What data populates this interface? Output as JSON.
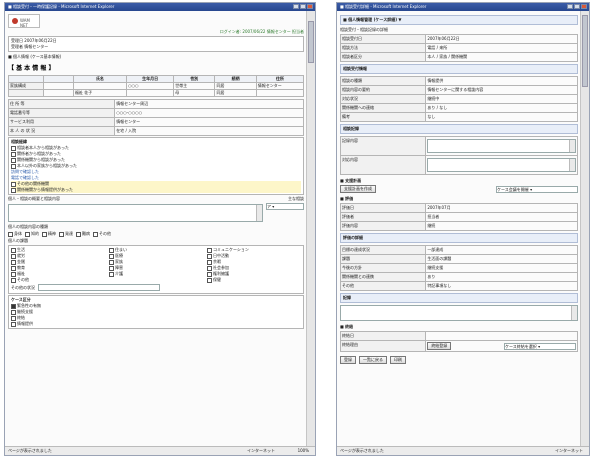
{
  "left_window": {
    "title": "■ 相談受付・一時保護記録 - Microsoft Internet Explorer",
    "logo_text": "WAM NET",
    "user_line": "ログイン者: 2007/06/22  情報センター 担当者",
    "header_rows": [
      "受理日  2007年06月22日",
      "受理者  情報センター"
    ],
    "section_title": "■ 個人情報 (ケース基本情報)",
    "basic_heading": "【 基 本 情 報 】",
    "basic_table": {
      "headers": [
        "",
        "",
        "氏名",
        "生年月日",
        "性別",
        "続柄",
        "住所"
      ],
      "rows": [
        [
          "家族構成",
          "",
          "",
          "○○○",
          "世帯主",
          "同居",
          "情報センター"
        ],
        [
          "",
          "",
          "福祉 花子",
          "",
          "母",
          "同居",
          ""
        ],
        [
          "",
          "",
          "",
          "",
          "",
          "",
          ""
        ]
      ],
      "info_rows": [
        [
          "住 所 等",
          "情報センター周辺"
        ],
        [
          "電話番号等",
          "○○○-○○○○"
        ],
        [
          "サービス利用",
          "情報センター"
        ],
        [
          "本 人 の 状 況",
          "在宅 / 入院"
        ]
      ]
    },
    "status_label": "相談経緯",
    "status_items": [
      "相談者本人から相談があった",
      "関係者から相談があった",
      "関係機関から相談があった",
      "本人以外の家族から相談があった"
    ],
    "status_links": [
      "訪問で確認した",
      "電話で確認した"
    ],
    "status_yellow_items": [
      "その他の関係機関",
      "関係機関から情報提供があった"
    ],
    "consult_label": "個人・相談の概要と相談内容",
    "consult_side_label": "主な相談",
    "consult_select": "ア",
    "checks_label": "個人の相談内容の種類",
    "checks_row": [
      "身体",
      "知的",
      "精神",
      "発達",
      "難病",
      "その他"
    ],
    "checks2_label": "個人の課題",
    "checks2": [
      "生活",
      "住まい",
      "就労",
      "医療",
      "金銭",
      "家族",
      "教育",
      "障害",
      "福祉",
      "介護",
      "その他",
      "",
      "コミュニケーション",
      "日中活動",
      "余暇",
      "社会参加",
      "権利擁護",
      "保健"
    ],
    "other_label": "その他の状況",
    "bottom_label": "ケース区分",
    "bottom_items": [
      "緊急性の有無",
      "継続支援",
      "終結",
      "情報提供"
    ],
    "status_text": "ページが表示されました",
    "status_zone": "インターネット",
    "status_zoom": "100%"
  },
  "right_window": {
    "title": "■ 相談受付詳細 - Microsoft Internet Explorer",
    "section_title": "■ 個人情報管理 (ケース詳細) ▼",
    "sub_title": "相談受付・相談記録の詳細",
    "form_rows": [
      [
        "相談受付日",
        "2007年06月22日"
      ],
      [
        "相談方法",
        "電話 / 来所"
      ],
      [
        "相談者区分",
        "本人 / 家族 / 関係機関"
      ]
    ],
    "group_header": "相談受付情報",
    "group_rows": [
      [
        "相談の種類",
        "情報提供"
      ],
      [
        "相談内容の要約",
        "情報センターに関する相談内容"
      ],
      [
        "対応状況",
        "継続中"
      ],
      [
        "関係機関への連絡",
        "あり / なし"
      ],
      [
        "備考",
        "なし"
      ]
    ],
    "notes_label": "相談記録",
    "notes_rows": [
      "記録内容",
      "対応内容"
    ],
    "support_title": "■ 支援計画",
    "support_button": "支援計画を作成",
    "support_select": "ケース会議を開催",
    "eval_title": "■ 評価",
    "eval_rows": [
      [
        "評価日",
        "2007年07月"
      ],
      [
        "評価者",
        "担当者"
      ],
      [
        "評価内容",
        "継続"
      ]
    ],
    "eval_group_header": "評価の詳細",
    "eval_group_rows": [
      [
        "目標の達成状況",
        "一部達成"
      ],
      [
        "課題",
        "生活面の課題"
      ],
      [
        "今後の方針",
        "継続支援"
      ],
      [
        "関係機関との連携",
        "あり"
      ],
      [
        "その他",
        "特記事項なし"
      ]
    ],
    "record_label": "記録",
    "close_title": "■ 終結",
    "close_rows": [
      [
        "終結日",
        ""
      ],
      [
        "終結理由",
        ""
      ]
    ],
    "close_button": "終結登録",
    "close_select": "ケース終結を選択",
    "footer_buttons": [
      "登録",
      "一覧に戻る",
      "印刷"
    ],
    "status_text": "ページが表示されました",
    "status_zone": "インターネット"
  }
}
